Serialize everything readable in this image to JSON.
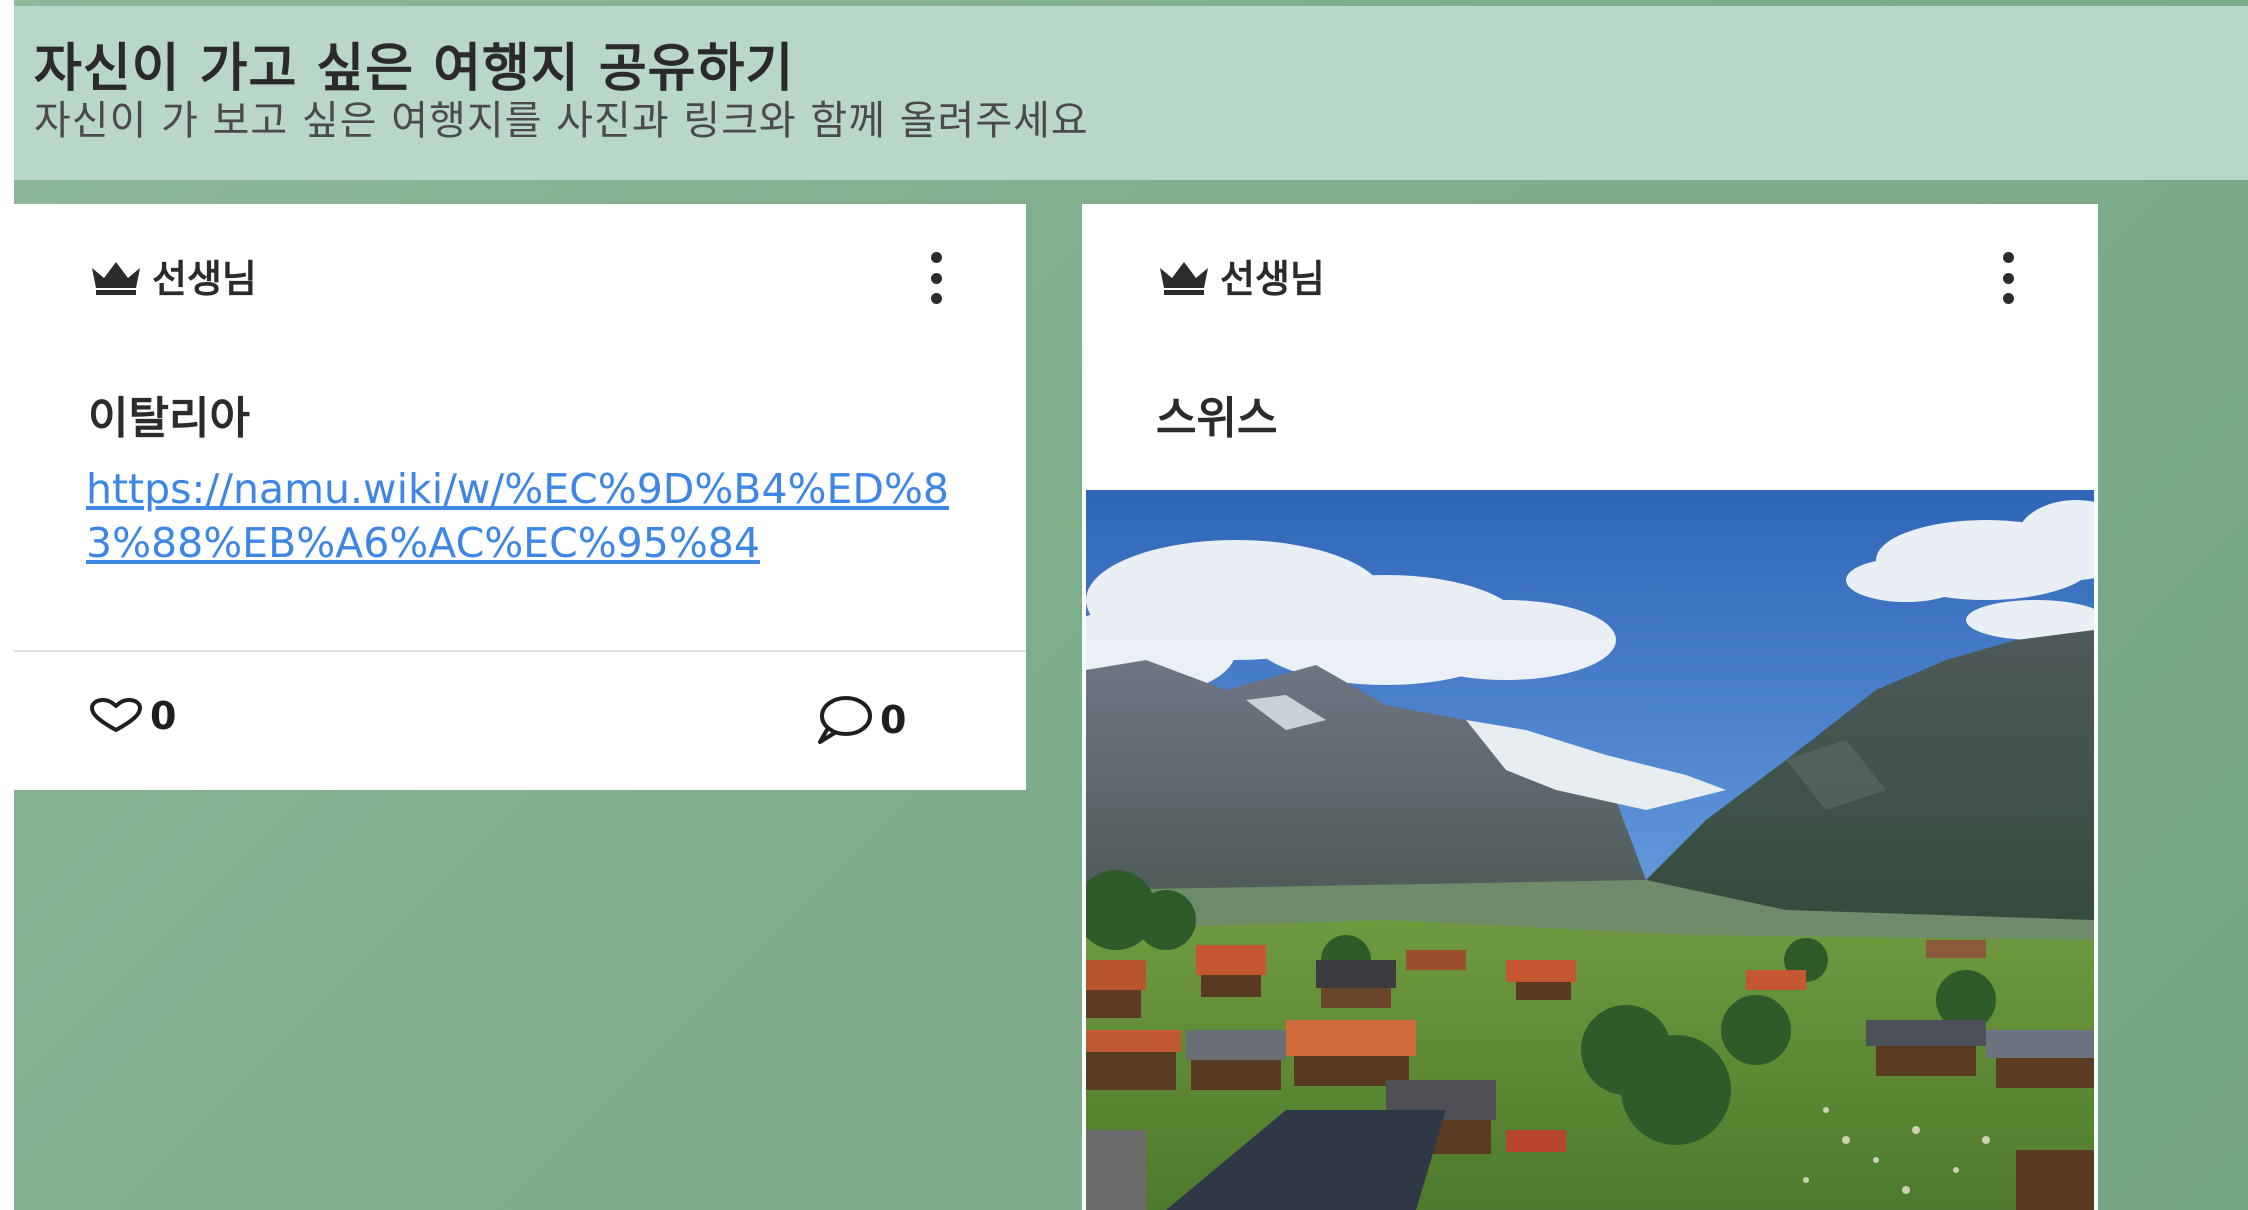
{
  "header": {
    "title": "자신이 가고 싶은 여행지 공유하기",
    "description": "자신이 가 보고 싶은 여행지를 사진과 링크와 함께 올려주세요"
  },
  "posts": [
    {
      "author": "선생님",
      "title": "이탈리아",
      "link": "https://namu.wiki/w/%EC%9D%B4%ED%83%88%EB%A6%AC%EC%95%84",
      "likes": "0",
      "comments": "0"
    },
    {
      "author": "선생님",
      "title": "스위스",
      "image": "photo of an alpine valley village under mountains"
    }
  ],
  "colors": {
    "board_background": "#7fae8c",
    "header_background": "#b9d7c8",
    "link": "#3e86e6"
  },
  "icons": [
    "crown-icon",
    "kebab-menu-icon",
    "heart-icon",
    "comment-icon"
  ]
}
